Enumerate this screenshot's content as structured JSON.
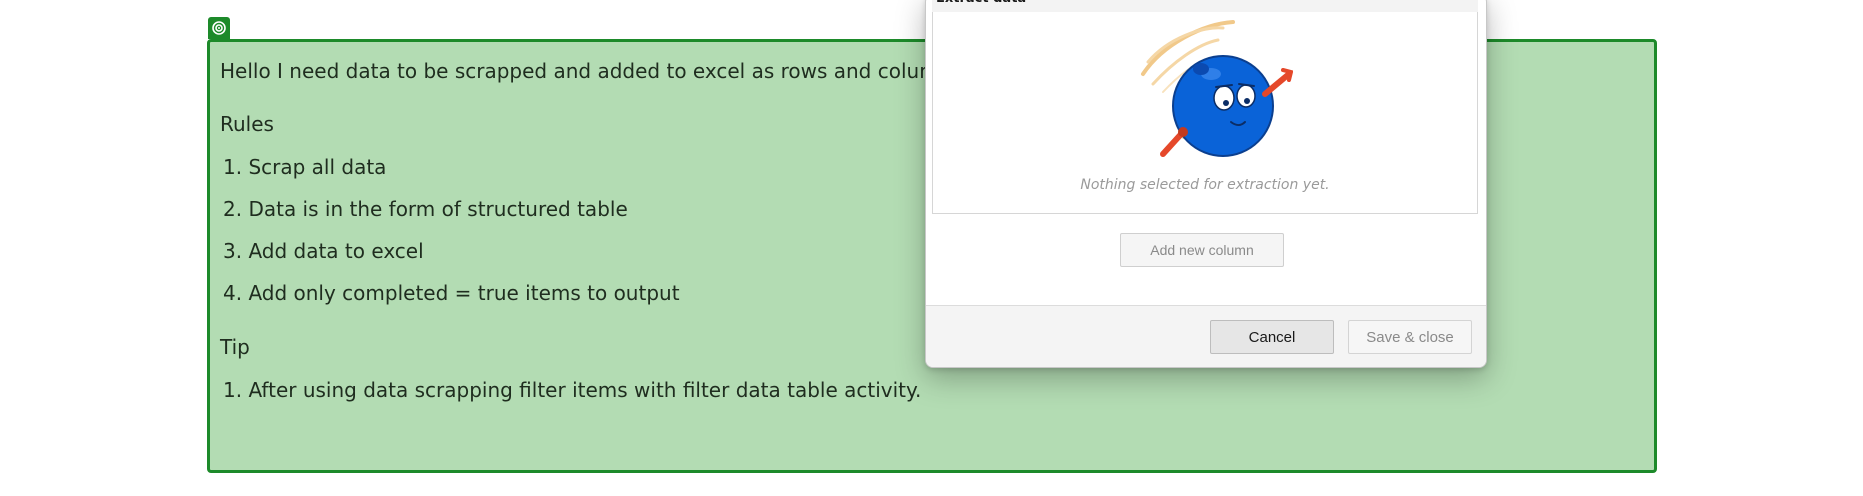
{
  "highlight": {
    "intro": "Hello I need data to be scrapped and added to excel as rows and columns, p",
    "rules_heading": "Rules",
    "rules": [
      "1. Scrap all data",
      "2. Data is in the form of structured table",
      "3. Add data to excel",
      "4. Add only completed = true items to output"
    ],
    "tip_heading": "Tip",
    "tips": [
      "1. After using data scrapping filter items with filter data table activity."
    ],
    "border_color": "#1d8a2a",
    "fill_color": "#b3dcb3"
  },
  "dialog": {
    "title": "Extract data",
    "empty_message": "Nothing selected for extraction yet.",
    "add_column_label": "Add new column",
    "cancel_label": "Cancel",
    "save_label": "Save & close"
  }
}
